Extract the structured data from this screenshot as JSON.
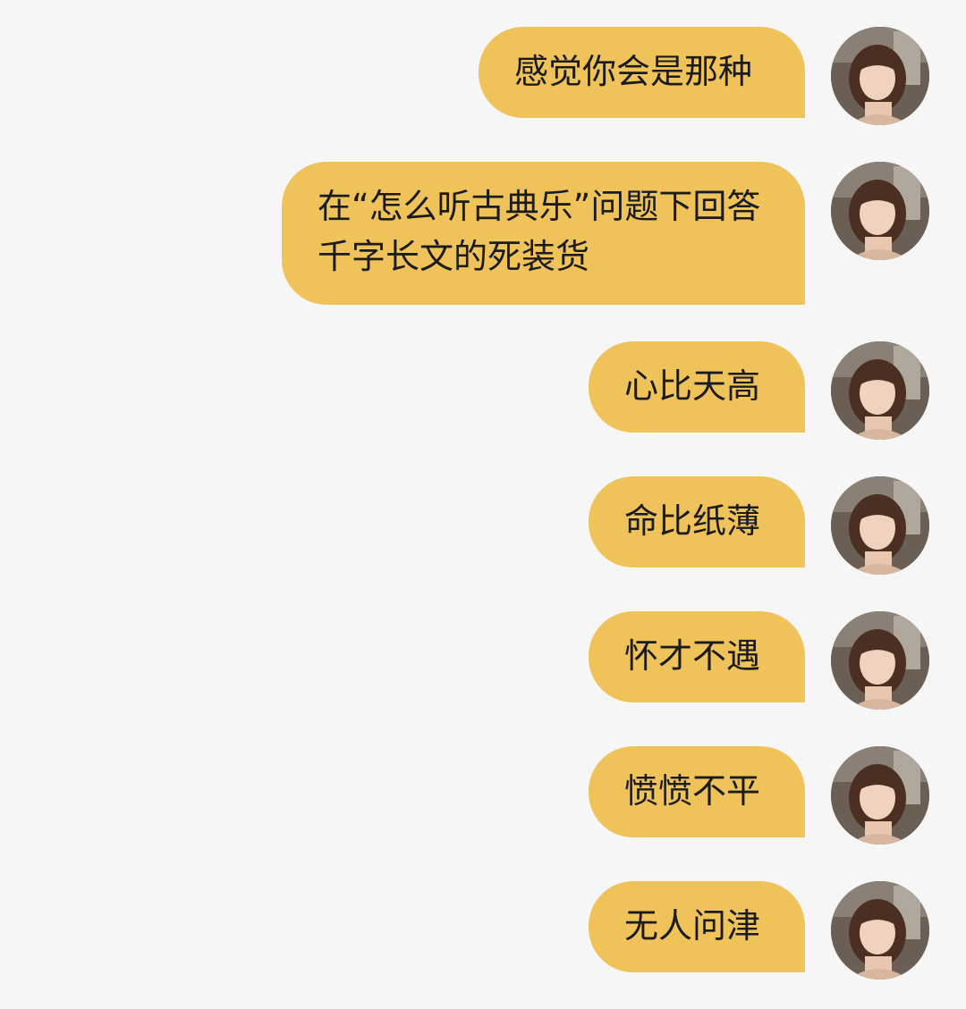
{
  "messages": [
    {
      "text": "感觉你会是那种"
    },
    {
      "text": "在“怎么听古典乐”问题下回答千字长文的死装货"
    },
    {
      "text": "心比天高"
    },
    {
      "text": "命比纸薄"
    },
    {
      "text": "怀才不遇"
    },
    {
      "text": "愤愤不平"
    },
    {
      "text": "无人问津"
    }
  ],
  "colors": {
    "background": "#f6f6f6",
    "bubble": "#efc35a",
    "text": "#1b1b1b"
  },
  "icons": {
    "avatar": "avatar-icon"
  }
}
